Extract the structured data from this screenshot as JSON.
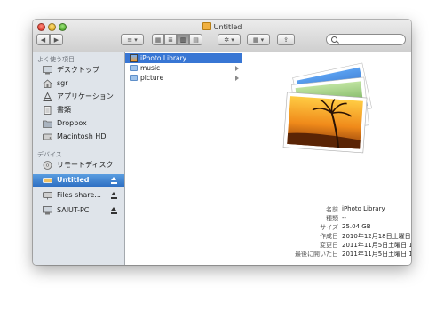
{
  "window": {
    "title": "Untitled"
  },
  "toolbar": {
    "nav_back": "◀",
    "nav_forward": "▶",
    "arrange_label": "≡ ▾",
    "view_icons": "▦",
    "view_list": "≣",
    "view_columns": "▥",
    "view_coverflow": "▤",
    "action_label": "✲ ▾",
    "arrange2_label": "▦ ▾",
    "share_label": "⇪",
    "search_placeholder": ""
  },
  "sidebar": {
    "favorites_header": "よく使う項目",
    "favorites": [
      {
        "label": "デスクトップ",
        "icon": "desktop-icon"
      },
      {
        "label": "sgr",
        "icon": "home-icon"
      },
      {
        "label": "アプリケーション",
        "icon": "applications-icon"
      },
      {
        "label": "書類",
        "icon": "documents-icon"
      },
      {
        "label": "Dropbox",
        "icon": "folder-icon"
      },
      {
        "label": "Macintosh HD",
        "icon": "hard-drive-icon"
      }
    ],
    "devices_header": "デバイス",
    "devices": [
      {
        "label": "リモートディスク",
        "icon": "remote-disc-icon",
        "eject": false
      },
      {
        "label": "Untitled",
        "icon": "drive-icon",
        "eject": true,
        "selected": true
      },
      {
        "label": "Files share...",
        "icon": "network-drive-icon",
        "eject": true
      },
      {
        "label": "SAIUT-PC",
        "icon": "pc-icon",
        "eject": true
      }
    ]
  },
  "column": {
    "items": [
      {
        "label": "iPhoto Library",
        "selected": true,
        "arrow": false
      },
      {
        "label": "music",
        "selected": false,
        "arrow": true
      },
      {
        "label": "picture",
        "selected": false,
        "arrow": true
      }
    ]
  },
  "info": {
    "rows": [
      {
        "label": "名前",
        "value": "iPhoto Library"
      },
      {
        "label": "種類",
        "value": "--"
      },
      {
        "label": "サイズ",
        "value": "25.04 GB"
      },
      {
        "label": "作成日",
        "value": "2010年12月18日土曜日 0:48"
      },
      {
        "label": "変更日",
        "value": "2011年11月5日土曜日 16:23"
      },
      {
        "label": "最後に開いた日",
        "value": "2011年11月5日土曜日 16:23"
      }
    ]
  },
  "colors": {
    "selection": "#3876d4",
    "sidebar_bg": "#dfe4ea"
  }
}
